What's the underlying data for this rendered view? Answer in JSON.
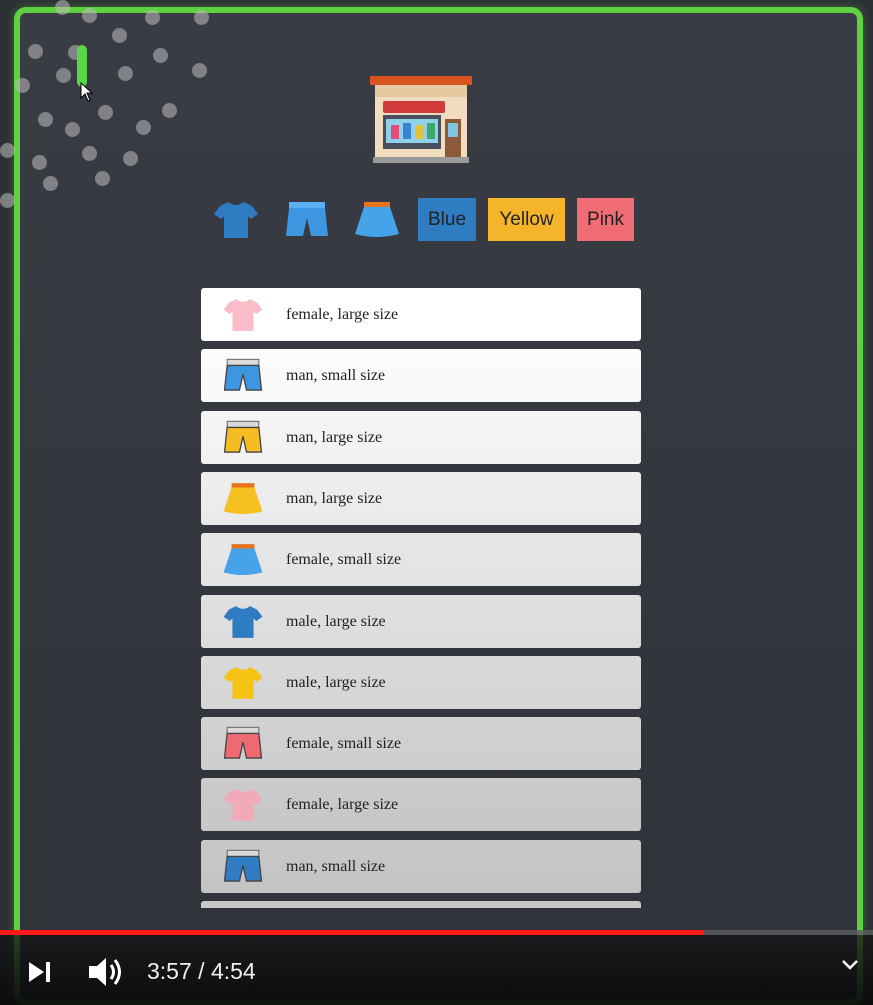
{
  "filters": {
    "shirt_icon": "tshirt-icon",
    "shorts_icon": "shorts-icon",
    "skirt_icon": "skirt-icon",
    "blue_label": "Blue",
    "yellow_label": "Yellow",
    "pink_label": "Pink"
  },
  "colors": {
    "frame": "#5fd140",
    "blue": "#2f7cc3",
    "yellow": "#f4b52a",
    "pink": "#f06d76",
    "progress": "#ff1a1a"
  },
  "products": [
    {
      "type": "tshirt",
      "color": "#f9bcc8",
      "text": "female, large size"
    },
    {
      "type": "shorts",
      "color": "#3e95e0",
      "text": "man, small size"
    },
    {
      "type": "shorts",
      "color": "#f6bd23",
      "text": "man, large size"
    },
    {
      "type": "skirt",
      "color": "#f6c020",
      "text": "man, large size"
    },
    {
      "type": "skirt",
      "color": "#46a3ea",
      "text": "female, small size"
    },
    {
      "type": "tshirt",
      "color": "#2f7cc3",
      "text": "male, large size"
    },
    {
      "type": "tshirt",
      "color": "#f5c313",
      "text": "male, large size"
    },
    {
      "type": "shorts",
      "color": "#ef6a70",
      "text": "female, small size"
    },
    {
      "type": "tshirt",
      "color": "#f2aab8",
      "text": "female, large size"
    },
    {
      "type": "shorts",
      "color": "#2f7cc3",
      "text": "man, small size"
    }
  ],
  "player": {
    "current_time": "3:57",
    "separator": "/",
    "duration": "4:54",
    "progress_fraction": 0.806,
    "next_icon": "skip-next-icon",
    "volume_icon": "volume-icon",
    "more_icon": "chevron-down-icon"
  }
}
